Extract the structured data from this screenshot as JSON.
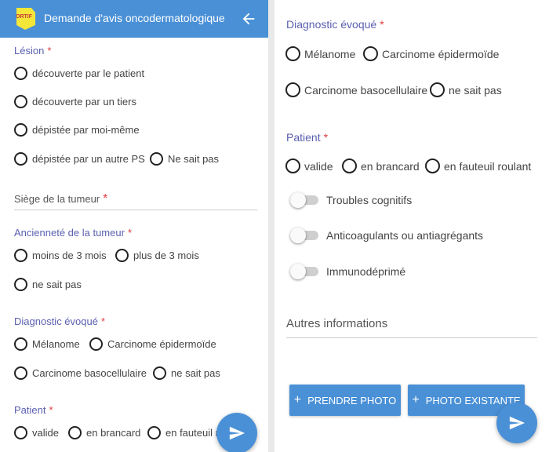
{
  "colors": {
    "primary": "#4a90d6",
    "label": "#5a5fb0",
    "required": "#e03c3c"
  },
  "appbar": {
    "title": "Demande d'avis oncodermatologique",
    "logo_text": "ORTIF"
  },
  "left": {
    "lesion": {
      "label": "Lésion",
      "required": "*",
      "options": [
        "découverte par le patient",
        "découverte par un tiers",
        "dépistée par moi-même",
        "dépistée par un autre PS",
        "Ne sait pas"
      ]
    },
    "siege": {
      "label": "Siège de la tumeur",
      "required": "*"
    },
    "anciennete": {
      "label": "Ancienneté de la tumeur",
      "required": "*",
      "options": [
        "moins de 3 mois",
        "plus de 3 mois",
        "ne sait pas"
      ]
    },
    "diagnostic": {
      "label": "Diagnostic évoqué",
      "required": "*",
      "options": [
        "Mélanome",
        "Carcinome épidermoïde",
        "Carcinome basocellulaire",
        "ne sait pas"
      ]
    },
    "patient": {
      "label": "Patient",
      "required": "*",
      "options": [
        "valide",
        "en brancard",
        "en fauteuil r"
      ]
    }
  },
  "right": {
    "diagnostic": {
      "label": "Diagnostic évoqué",
      "required": "*",
      "options": [
        "Mélanome",
        "Carcinome épidermoïde",
        "Carcinome basocellulaire",
        "ne sait pas"
      ]
    },
    "patient": {
      "label": "Patient",
      "required": "*",
      "options": [
        "valide",
        "en brancard",
        "en fauteuil roulant"
      ]
    },
    "toggles": [
      "Troubles cognitifs",
      "Anticoagulants ou antiagrégants",
      "Immunodéprimé"
    ],
    "autres": {
      "label": "Autres informations"
    },
    "buttons": {
      "take_photo": "PRENDRE PHOTO",
      "existing_photo": "PHOTO EXISTANTE",
      "plus": "+"
    }
  }
}
